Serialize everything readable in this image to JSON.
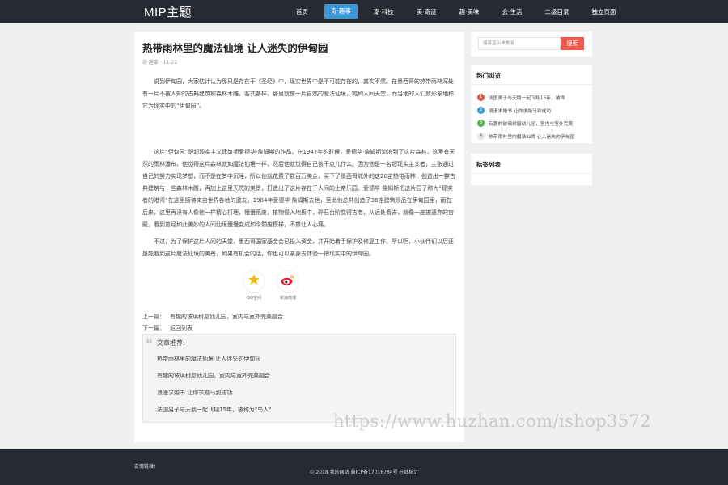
{
  "header": {
    "logo": "MIP主题",
    "nav": [
      {
        "label": "首页",
        "active": false
      },
      {
        "label": "奇·趣事",
        "active": true
      },
      {
        "label": "潮·科技",
        "active": false
      },
      {
        "label": "美·奇迹",
        "active": false
      },
      {
        "label": "趣·美味",
        "active": false
      },
      {
        "label": "会·生活",
        "active": false
      },
      {
        "label": "二级目录",
        "active": false
      },
      {
        "label": "独立页面",
        "active": false
      }
    ]
  },
  "article": {
    "title": "热带雨林里的魔法仙境 让人迷失的伊甸园",
    "meta": "奇·趣事 · 11-22",
    "paragraphs": [
      "说到伊甸园，大家估计认为那只是存在于《圣经》中，现实世界中是不可能存在的，其实不然。在墨西哥的热带雨林深处有一片不被人知的古典建筑和森林木雕，各式各样，那里就像一片自然的魔法仙境，宛如人间天堂，而当地的人们就形象地称它为现实中的“伊甸园”。",
      "这片“伊甸园”是超现实主义建筑师爱德华·詹姆斯的作品。在1947年的时候，爱德华·詹姆斯流浪到了这片森林，这里有天然的雨林瀑布，他觉得这片森林就如魔法仙境一样，然后他就觉得自己该干点儿什么。因为他是一名超现实主义者，主张通过自己的努力实现梦想，而不是在梦中沉睡，所以他就花费了数百万美金，买下了墨西哥城外的这20亩热带雨林，创造出一群古典建筑与一些森林木雕，再加上这里天然的美景，打造出了这片存在于人间的上帝乐园。爱德华·詹姆斯把这片园子称为“现实者的港湾”在这里接待来自世界各地的遨友。1984年爱德华·詹姆斯去世，至此他总共创造了36座建筑珍品在伊甸园里，而在后来，这里再没有人像他一样精心打理，慢慢荒废，植物侵入地板中，碎石台阶变得古老，从远处看去，就像一座被遗弃的宫殿。看到曾经如此美妙的人间仙境慢慢变成如今颓废模样，不禁让人心痛。",
      "不过，为了保护这片人间的天堂，墨西哥国家基金会已投入资金，并开始着手保护及修复工作。所以啊，小伙伴们以后还是能看到这片魔法仙境的美景，如果有机会的话，你也可以亲身去体验一把现实中的伊甸园。"
    ],
    "share": [
      {
        "icon": "qzone-star-icon",
        "label": "QQ空间",
        "color": "#f6b90c"
      },
      {
        "icon": "weibo-icon",
        "label": "新浪微博",
        "color": "#e6162d"
      }
    ],
    "prev_label": "上一篇：",
    "prev_title": "有趣的玻璃树屋幼儿园，室内与室外完美融合",
    "next_label": "下一篇：",
    "next_title": "返回列表"
  },
  "recommend": {
    "title": "文章推荐:",
    "items": [
      "热带雨林里的魔法仙境 让人迷失的伊甸园",
      "有趣的玻璃树屋幼儿园，室内与室外完美融合",
      "浪漫求婚书 让你求婚马到成功",
      "法国男子与天鹅一起飞翔15年，被称为\"鸟人\""
    ]
  },
  "sidebar": {
    "search_placeholder": "搜索显示神美港",
    "search_button": "搜索",
    "hot_title": "热门浏览",
    "hot_items": [
      {
        "rank": "1",
        "title": "法国男子与天鹅一起飞翔15年，被称",
        "color": "#e05548"
      },
      {
        "rank": "2",
        "title": "浪漫求婚书 让你求婚马到成功",
        "color": "#3a9bd6"
      },
      {
        "rank": "3",
        "title": "有趣的玻璃树屋幼儿园，室内与室外完美",
        "color": "#53b146"
      },
      {
        "rank": "4",
        "title": "热带雨林里的魔法仙境 让人迷失的伊甸园",
        "color": "#e7e7e7"
      }
    ],
    "tags_title": "标签列表"
  },
  "footer": {
    "links_label": "友情链接：",
    "copyright": "© 2018 我的网站 冀ICP备17016784号 在线统计"
  },
  "watermark": "https://www.huzhan.com/ishop3572"
}
